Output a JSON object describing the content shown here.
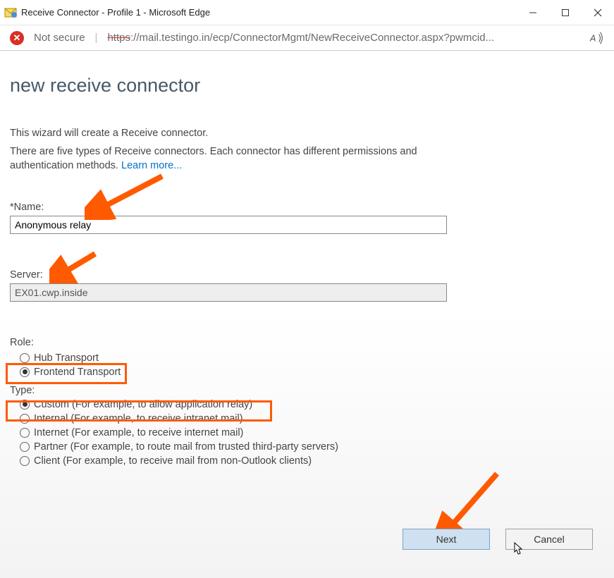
{
  "window": {
    "title": "Receive Connector - Profile 1 - Microsoft Edge"
  },
  "address": {
    "not_secure": "Not secure",
    "url_prefix": "https",
    "url_rest": "://mail.testingo.in/ecp/ConnectorMgmt/NewReceiveConnector.aspx?pwmcid..."
  },
  "page": {
    "title": "new receive connector",
    "intro1": "This wizard will create a Receive connector.",
    "intro2a": "There are five types of Receive connectors. Each connector has different permissions and authentication methods. ",
    "learn_more": "Learn more...",
    "name_label": "*Name:",
    "name_value": "Anonymous relay",
    "server_label": "Server:",
    "server_value": "EX01.cwp.inside",
    "role_label": "Role:",
    "role_options": [
      {
        "label": "Hub Transport",
        "selected": false
      },
      {
        "label": "Frontend Transport",
        "selected": true
      }
    ],
    "type_label": "Type:",
    "type_options": [
      {
        "label": "Custom (For example, to allow application relay)",
        "selected": true
      },
      {
        "label": "Internal (For example, to receive intranet mail)",
        "selected": false
      },
      {
        "label": "Internet (For example, to receive internet mail)",
        "selected": false
      },
      {
        "label": "Partner (For example, to route mail from trusted third-party servers)",
        "selected": false
      },
      {
        "label": "Client (For example, to receive mail from non-Outlook clients)",
        "selected": false
      }
    ],
    "next_btn": "Next",
    "cancel_btn": "Cancel"
  }
}
